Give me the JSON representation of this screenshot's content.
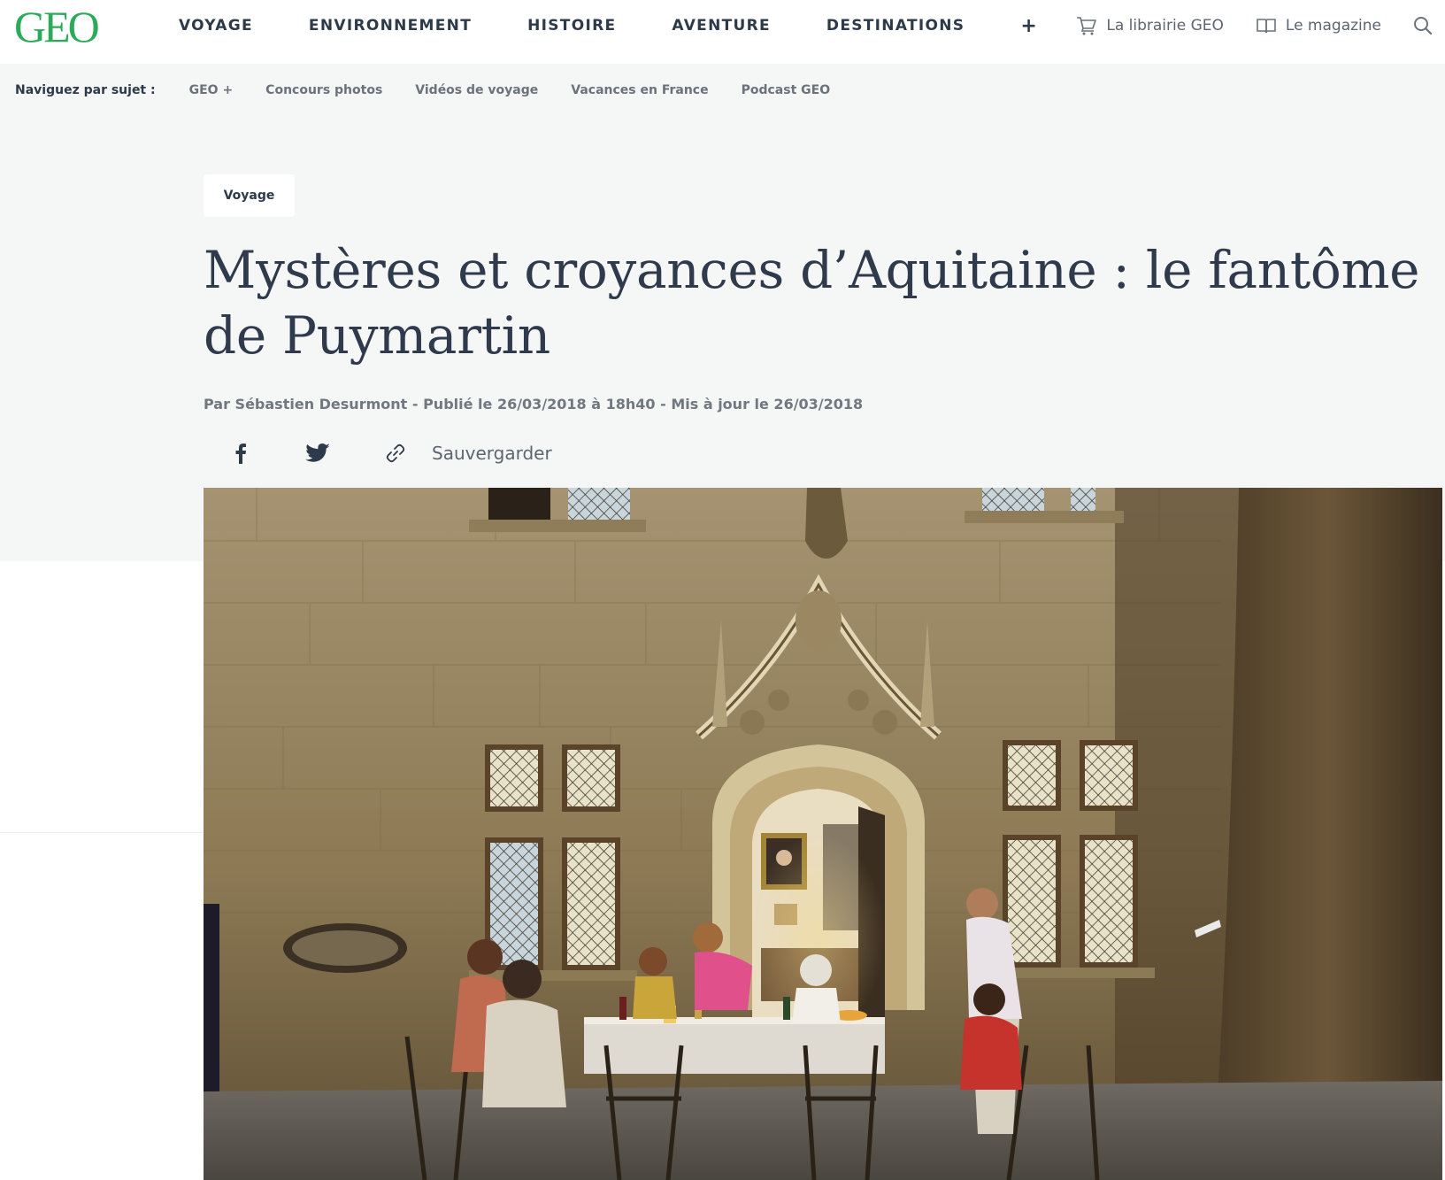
{
  "brand": {
    "logo_text": "GEO",
    "logo_color": "#2bab5a"
  },
  "main_nav": {
    "items": [
      "VOYAGE",
      "ENVIRONNEMENT",
      "HISTOIRE",
      "AVENTURE",
      "DESTINATIONS"
    ],
    "more_label": "+"
  },
  "header_links": {
    "bookshop": {
      "label": "La librairie GEO",
      "icon": "cart-icon"
    },
    "magazine": {
      "label": "Le magazine",
      "icon": "book-icon"
    },
    "search_icon": "search-icon"
  },
  "sub_nav": {
    "title": "Naviguez par sujet :",
    "items": [
      "GEO +",
      "Concours photos",
      "Vidéos de voyage",
      "Vacances en France",
      "Podcast GEO"
    ]
  },
  "article": {
    "category": "Voyage",
    "title": "Mystères et croyances d’Aquitaine : le fantôme de Puymartin",
    "byline": "Par Sébastien Desurmont - Publié le 26/03/2018 à 18h40 - Mis à jour le 26/03/2018",
    "share": {
      "facebook_icon": "facebook-icon",
      "twitter_icon": "twitter-icon",
      "link_icon": "link-icon",
      "save_label": "Sauvergarder"
    }
  },
  "colors": {
    "text_dark": "#2f3b4c",
    "text_muted": "#717880",
    "grey_band": "#f5f6f6"
  }
}
